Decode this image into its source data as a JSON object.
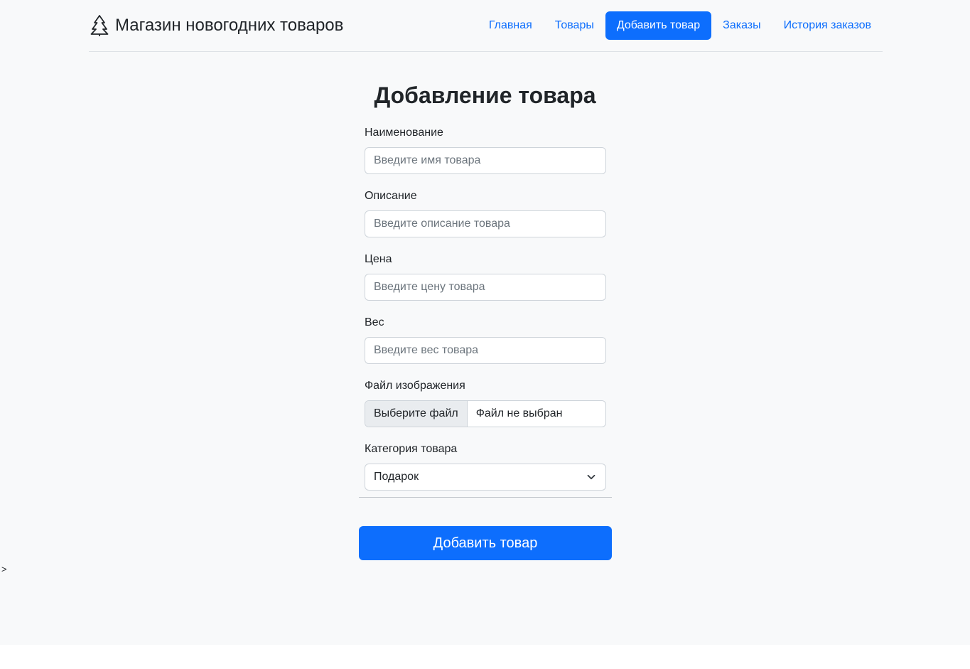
{
  "header": {
    "brand": "Магазин новогодних товаров",
    "brand_icon": "tree-icon",
    "nav": [
      {
        "label": "Главная",
        "active": false
      },
      {
        "label": "Товары",
        "active": false
      },
      {
        "label": "Добавить товар",
        "active": true
      },
      {
        "label": "Заказы",
        "active": false
      },
      {
        "label": "История заказов",
        "active": false
      }
    ]
  },
  "form": {
    "title": "Добавление товара",
    "name": {
      "label": "Наименование",
      "placeholder": "Введите имя товара",
      "value": ""
    },
    "description": {
      "label": "Описание",
      "placeholder": "Введите описание товара",
      "value": ""
    },
    "price": {
      "label": "Цена",
      "placeholder": "Введите цену товара",
      "value": ""
    },
    "weight": {
      "label": "Вес",
      "placeholder": "Введите вес товара",
      "value": ""
    },
    "image": {
      "label": "Файл изображения",
      "button": "Выберите файл",
      "status": "Файл не выбран"
    },
    "category": {
      "label": "Категория товара",
      "selected": "Подарок"
    },
    "submit": "Добавить товар"
  },
  "stray_text": ">",
  "colors": {
    "primary": "#0d6efd",
    "background": "#f8f9fa",
    "border": "#ced4da",
    "text": "#212529"
  }
}
